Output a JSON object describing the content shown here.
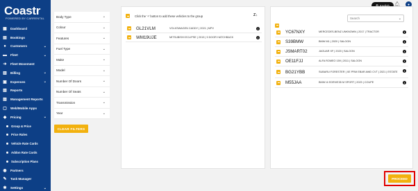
{
  "app": {
    "logo": "Coastr",
    "logo_sub": "POWERED BY CARRENTAL"
  },
  "sidebar": {
    "items": [
      {
        "label": "Dashboard",
        "icon": "dashboard-icon"
      },
      {
        "label": "Bookings",
        "icon": "bookings-icon"
      },
      {
        "label": "Customers",
        "icon": "customers-icon",
        "chevron": true
      },
      {
        "label": "Fleet",
        "icon": "fleet-icon",
        "chevron": true
      },
      {
        "label": "Fleet Movement",
        "icon": "fleet-movement-icon"
      },
      {
        "label": "Billing",
        "icon": "billing-icon",
        "chevron": true
      },
      {
        "label": "Expenses",
        "icon": "expenses-icon",
        "chevron": true
      },
      {
        "label": "Reports",
        "icon": "reports-icon"
      },
      {
        "label": "Management Reports",
        "icon": "management-reports-icon"
      },
      {
        "label": "Web/Mobile Apps",
        "icon": "apps-icon"
      },
      {
        "label": "Pricing",
        "icon": "pricing-icon",
        "chevron": true
      }
    ],
    "sub_items": [
      {
        "label": "Group & Price"
      },
      {
        "label": "Price Rules"
      },
      {
        "label": "Vehicle Rate Cards"
      },
      {
        "label": "Addon Rate Cards"
      },
      {
        "label": "Subscription Plans"
      }
    ],
    "bottom_items": [
      {
        "label": "Partners",
        "icon": "partners-icon"
      },
      {
        "label": "Task Manager",
        "icon": "task-manager-icon"
      },
      {
        "label": "Settings",
        "icon": "settings-icon",
        "chevron": true
      }
    ]
  },
  "topbar": {
    "language": "English",
    "notification_sub": "A ↓",
    "avatar_icon": "user-icon"
  },
  "filters": {
    "items": [
      "Body Type",
      "Colour",
      "Features",
      "Fuel Type",
      "Make",
      "Model",
      "Number Of Doors",
      "Number Of Seats",
      "Transmission",
      "Year"
    ],
    "clear_label": "CLEAR FILTERS"
  },
  "middle": {
    "hint": "Click the '+' button to add these vehicles to the group",
    "sort_icon": "Z↓",
    "vehicles": [
      {
        "plate": "GL21VLM",
        "desc": "VOLKSWAGEN CADDY | 2021 | MPV"
      },
      {
        "plate": "WM19UJE",
        "desc": "MITSUBISHI ECLIPSE | 2019 | 5 DOOR HATCHBACK"
      }
    ]
  },
  "right": {
    "search_placeholder": "Search",
    "vehicles": [
      {
        "plate": "YC67NXY",
        "desc": "MERCEDES-BENZ UNKNOWN | 2017 | TRACTOR"
      },
      {
        "plate": "S39BMW",
        "desc": "BMW M1 | 2020 | SALOON"
      },
      {
        "plate": "JSMART02",
        "desc": "JAGUAR XF | 2020 | SALOON"
      },
      {
        "plate": "OE11FJJ",
        "desc": "ALFA ROMEO 159 | 2011 | SALOON"
      },
      {
        "plate": "BG21YBB",
        "desc": "SUBARU FORESTER | XE PRM EBAR AWD CVT | 2021 | ESTATE"
      },
      {
        "plate": "M55JAA",
        "desc": "BMW I4 EDRIVE35 M SPORT | 2023 | COUPE"
      }
    ]
  },
  "actions": {
    "proceed_label": "PROCEED"
  },
  "colors": {
    "sidebar": "#0d3f86",
    "accent": "#f2b10e",
    "highlight": "#e00000"
  }
}
